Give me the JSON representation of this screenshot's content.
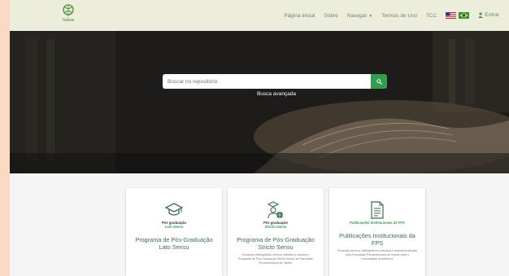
{
  "logo": {
    "text": "Sabus"
  },
  "nav": {
    "home": "Página inicial",
    "about": "Sobre",
    "browse": "Navegar",
    "terms": "Termos de Uso",
    "tcc": "TCC",
    "login": "Entrar"
  },
  "search": {
    "placeholder": "Buscar no repositório",
    "advanced": "Busca avançada"
  },
  "cards": [
    {
      "sub1": "Pós graduação",
      "sub2": "Lato Sensu",
      "title": "Programa de Pós-Graduação Lato Sensu",
      "desc": ""
    },
    {
      "sub1": "Pós graduação",
      "sub2": "Stricto Sensu",
      "title": "Programa de Pós-Graduação Stricto Sensu",
      "desc": "Produção bibliográfica, técnica, artística e cultural o Programa de Pós Graduação Stricto Sensu da Faculdade Pernambucana de Saúde."
    },
    {
      "sub1": "",
      "sub2": "Publicações Institucionais da FPS",
      "title": "Publicações Institucionais da FPS",
      "desc": "Produção técnica, bibliográfica e artística e cultural produzida pela Faculdade Pernambucana de Saúde para a Comunidade Acadêmica."
    }
  ],
  "colors": {
    "accent": "#2f9e4e",
    "nav_bg": "#ecedda",
    "title": "#3c6e48"
  }
}
